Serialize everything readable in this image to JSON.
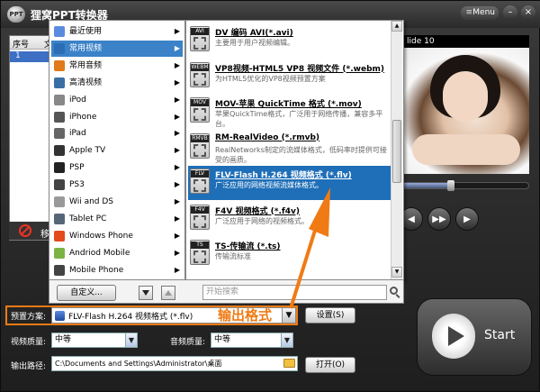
{
  "window": {
    "title": "狸窝PPT转换器",
    "logo_text": "PPT",
    "menu_label": "Menu",
    "minimize_glyph": "–",
    "close_glyph": "×"
  },
  "file_list": {
    "col_index": "序号",
    "col_file": "文",
    "row_index": "1",
    "move_label": "移"
  },
  "preview": {
    "slide_label": "lide 10",
    "progress": 0.42,
    "prev_glyph": "◀",
    "next_glyph": "▶▶",
    "play_glyph": "▶"
  },
  "menu_l1": {
    "items": [
      {
        "label": "最近使用",
        "icon": "recent-icon",
        "color": "#5b8be0"
      },
      {
        "label": "常用视频",
        "icon": "video-icon",
        "color": "#2a6db5",
        "active": true
      },
      {
        "label": "常用音频",
        "icon": "audio-icon",
        "color": "#e07a1a"
      },
      {
        "label": "高清视频",
        "icon": "hd-icon",
        "color": "#3a6ea5"
      },
      {
        "label": "iPod",
        "icon": "ipod-icon",
        "color": "#888888"
      },
      {
        "label": "iPhone",
        "icon": "iphone-icon",
        "color": "#555555"
      },
      {
        "label": "iPad",
        "icon": "ipad-icon",
        "color": "#666666"
      },
      {
        "label": "Apple TV",
        "icon": "appletv-icon",
        "color": "#333333"
      },
      {
        "label": "PSP",
        "icon": "psp-icon",
        "color": "#222222"
      },
      {
        "label": "PS3",
        "icon": "ps3-icon",
        "color": "#444444"
      },
      {
        "label": "Wii and DS",
        "icon": "wii-icon",
        "color": "#999999"
      },
      {
        "label": "Tablet PC",
        "icon": "tablet-icon",
        "color": "#556677"
      },
      {
        "label": "Windows Phone",
        "icon": "windows-phone-icon",
        "color": "#e24b1a"
      },
      {
        "label": "Andriod Mobile",
        "icon": "android-icon",
        "color": "#7cb342"
      },
      {
        "label": "Mobile Phone",
        "icon": "mobile-phone-icon",
        "color": "#444444"
      }
    ]
  },
  "menu_l2": {
    "items": [
      {
        "badge": "AVI",
        "title": "DV 编码 AVI(*.avi)",
        "desc": "主要用于用户视频编辑。"
      },
      {
        "badge": "WEBM",
        "title": "VP8视频-HTML5 VP8 视频文件 (*.webm)",
        "desc": "为HTML5优化的VP8视频预置方案"
      },
      {
        "badge": "MOV",
        "title": "MOV-苹果 QuickTime 格式 (*.mov)",
        "desc": "苹果QuickTime格式，广泛用于网络传播，兼容多平台。"
      },
      {
        "badge": "RMVB",
        "title": "RM-RealVideo (*.rmvb)",
        "desc": "RealNetworks制定的流媒体格式，低码率时提供可接受的画质。"
      },
      {
        "badge": "FLV",
        "title": "FLV-Flash H.264 视频格式 (*.flv)",
        "desc": "广泛应用的网络视频流媒体格式。",
        "active": true
      },
      {
        "badge": "F4V",
        "title": "F4V 视频格式 (*.f4v)",
        "desc": "广泛应用于网络的视频格式。"
      },
      {
        "badge": "TS",
        "title": "TS-传输流 (*.ts)",
        "desc": "传输流标准"
      }
    ]
  },
  "menu_bottom": {
    "custom_label": "自定义...",
    "search_placeholder": "开始搜索"
  },
  "settings": {
    "profile_label": "预置方案:",
    "profile_value": "FLV-Flash H.264 视频格式 (*.flv)",
    "callout": "输出格式",
    "settings_button": "设置(S)",
    "video_quality_label": "视频质量:",
    "video_quality_value": "中等",
    "audio_quality_label": "音频质量:",
    "audio_quality_value": "中等",
    "output_path_label": "输出路径:",
    "output_path_value": "C:\\Documents and Settings\\Administrator\\桌面",
    "open_button": "打开(O)",
    "start_label": "Start"
  }
}
